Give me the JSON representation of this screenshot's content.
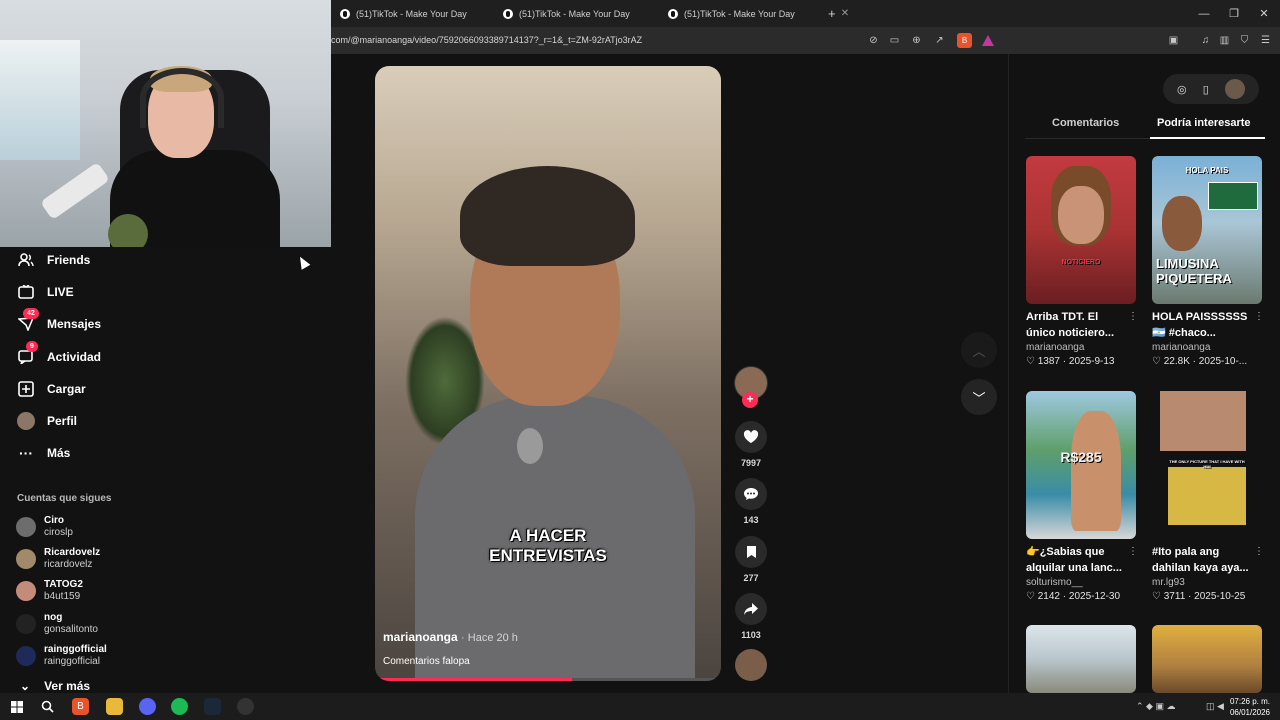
{
  "browser": {
    "tabs": [
      {
        "title": "(51)TikTok - Make Your Day"
      },
      {
        "title": "(51)TikTok - Make Your Day"
      },
      {
        "title": "(51)TikTok - Make Your Day"
      }
    ],
    "new_tab": "+",
    "url": "com/@marianoanga/video/7592066093389714137?_r=1&_t=ZM-92rATjo3rAZ"
  },
  "sidebar": {
    "items": [
      {
        "label": "Friends",
        "icon": "friends-icon"
      },
      {
        "label": "LIVE",
        "icon": "live-icon"
      },
      {
        "label": "Mensajes",
        "icon": "messages-icon",
        "badge": "42"
      },
      {
        "label": "Actividad",
        "icon": "activity-icon",
        "badge": "9"
      },
      {
        "label": "Cargar",
        "icon": "upload-icon"
      },
      {
        "label": "Perfil",
        "icon": "profile-avatar"
      },
      {
        "label": "Más",
        "icon": "more-icon"
      }
    ],
    "following_title": "Cuentas que sigues",
    "following": [
      {
        "name": "Ciro",
        "handle": "ciroslp"
      },
      {
        "name": "Ricardovelz",
        "handle": "ricardovelz"
      },
      {
        "name": "TATOG2",
        "handle": "b4ut159"
      },
      {
        "name": "nog",
        "handle": "gonsalitonto"
      },
      {
        "name": "rainggofficial",
        "handle": "rainggofficial"
      }
    ],
    "see_more": "Ver más"
  },
  "video": {
    "caption": "A HACER ENTREVISTAS",
    "author": "marianoanga",
    "time": "· Hace 20 h",
    "description": "Comentarios falopa",
    "progress": 0.57
  },
  "actions": {
    "likes": "7997",
    "comments": "143",
    "saves": "277",
    "shares": "1103"
  },
  "panel": {
    "tab_comments": "Comentarios",
    "tab_suggested": "Podría interesarte",
    "cards": [
      {
        "title": "Arriba TDT. El único noticiero...",
        "author": "marianoanga",
        "likes": "1387",
        "date": "2025-9-13",
        "overlay": "NOTICIERO"
      },
      {
        "title": "HOLA PAISSSSSS 🇦🇷 #chaco...",
        "author": "marianoanga",
        "likes": "22.8K",
        "date": "2025-10-...",
        "overlay": "LIMUSINA PIQUETERA",
        "overlay_top": "HOLA PAIS"
      },
      {
        "title": "👉¿Sabias que alquilar una lanc...",
        "author": "solturismo__",
        "likes": "2142",
        "date": "2025-12-30",
        "overlay": "R$285"
      },
      {
        "title": "#Ito pala ang dahilan kaya aya...",
        "author": "mr.lg93",
        "likes": "3711",
        "date": "2025-10-25",
        "overlay": "THE ONLY PICTURE THAT I HAVE WITH HIM"
      }
    ]
  },
  "taskbar": {
    "time": "07:26 p. m.",
    "date": "06/01/2026"
  },
  "colors": {
    "accent": "#fe2c55",
    "background": "#121212"
  }
}
